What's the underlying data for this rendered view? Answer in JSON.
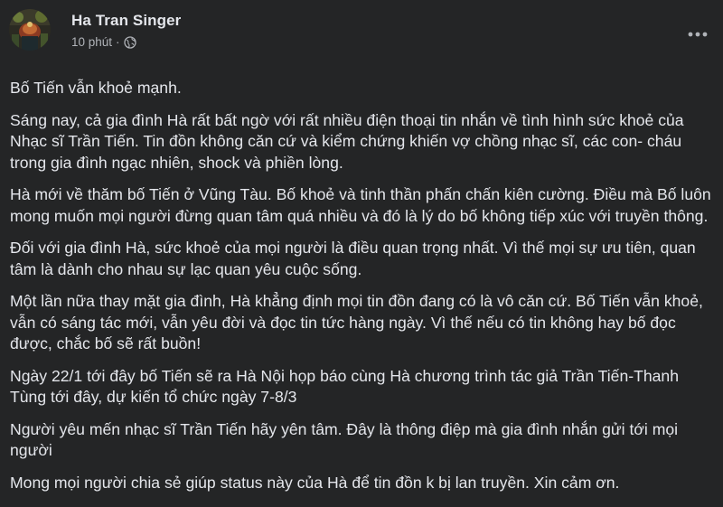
{
  "post": {
    "author": "Ha Tran Singer",
    "time": "10 phút",
    "separator": "·",
    "privacy_icon": "globe-icon",
    "more_icon": "more-options-icon",
    "paragraphs": [
      "Bố Tiến vẫn khoẻ mạnh.",
      "Sáng nay, cả gia đình Hà rất bất ngờ với rất nhiều điện thoại tin nhắn về tình hình sức khoẻ của Nhạc sĩ Trần Tiến. Tin đồn không căn cứ và kiểm chứng khiến vợ chồng nhạc sĩ, các con- cháu trong gia đình ngạc nhiên, shock và phiền lòng.",
      "Hà mới về thăm bố Tiến ở Vũng Tàu. Bố khoẻ và tinh thần phấn chấn kiên cường. Điều mà Bố luôn mong muốn mọi người đừng quan tâm quá nhiều và đó là lý do bố không tiếp xúc với truyền thông.",
      "Đối với gia đình Hà, sức khoẻ của mọi người là điều quan trọng nhất. Vì thế mọi sự ưu tiên, quan tâm là dành cho nhau sự lạc quan yêu cuộc sống.",
      "Một lần nữa thay mặt gia đình, Hà khẳng định mọi tin đồn đang có là vô căn cứ. Bố Tiến vẫn khoẻ, vẫn có sáng tác mới, vẫn yêu đời và đọc tin tức hàng ngày. Vì thế nếu có tin không hay bố đọc được, chắc bố sẽ rất buồn!",
      "Ngày 22/1 tới đây bố Tiến sẽ ra Hà Nội họp báo cùng Hà chương trình tác giả Trần Tiến-Thanh Tùng tới đây, dự kiến tổ chức ngày 7-8/3",
      "Người yêu mến nhạc sĩ Trần Tiến hãy yên tâm. Đây là thông điệp mà gia đình nhắn gửi tới mọi người",
      "Mong mọi người chia sẻ giúp status này của Hà để tin đồn k bị lan truyền. Xin cảm ơn."
    ]
  },
  "colors": {
    "background": "#242526",
    "primary_text": "#e4e6eb",
    "secondary_text": "#b0b3b8"
  }
}
